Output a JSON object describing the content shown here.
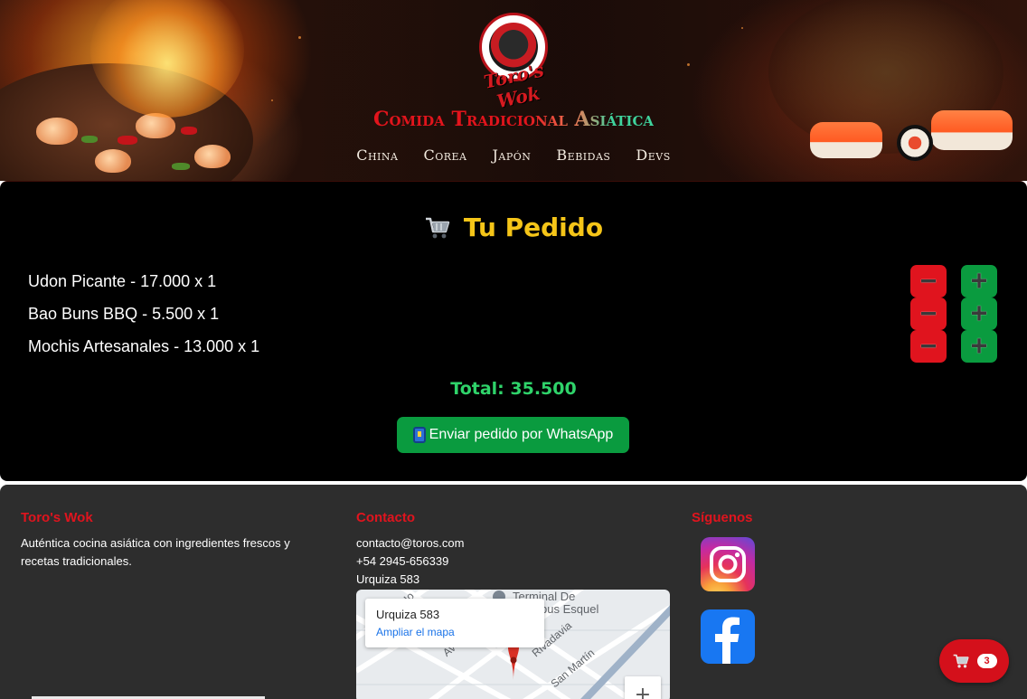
{
  "header": {
    "logo_text": "Toro's Wok",
    "tagline": "Comida Tradicional Asiática",
    "nav": [
      "China",
      "Corea",
      "Japón",
      "Bebidas",
      "Devs"
    ]
  },
  "order": {
    "title": "Tu Pedido",
    "title_icon": "shopping-cart-icon",
    "items": [
      {
        "text": "Udon Picante - 17.000 x 1"
      },
      {
        "text": "Bao Buns BBQ - 5.500 x 1"
      },
      {
        "text": "Mochis Artesanales - 13.000 x 1"
      }
    ],
    "minus_symbol": "➖",
    "plus_symbol": "➕",
    "total": "Total: 35.500",
    "whatsapp_button": "Enviar pedido por WhatsApp",
    "whatsapp_icon": "mobile-phone-icon"
  },
  "footer": {
    "brand": {
      "heading": "Toro's Wok",
      "description": "Auténtica cocina asiática con ingredientes frescos y recetas tradicionales."
    },
    "contact": {
      "heading": "Contacto",
      "email": "contacto@toros.com",
      "phone": "+54 2945-656339",
      "address": "Urquiza 583"
    },
    "map": {
      "place_title": "Urquiza 583",
      "enlarge_link": "Ampliar el mapa",
      "labels": [
        "Terminal De",
        "Ómnibus Esquel",
        "Rivadavia",
        "San Martín",
        "Av",
        "Ado"
      ],
      "zoom_in": "+"
    },
    "social": {
      "heading": "Síguenos",
      "networks": [
        "instagram-icon",
        "facebook-icon"
      ]
    }
  },
  "floating_cart": {
    "count": "3",
    "icon": "shopping-cart-icon"
  },
  "colors": {
    "accent_red": "#e0141e",
    "accent_green": "#0a9b3f",
    "title_yellow": "#f5c518",
    "total_green": "#2fd36a",
    "footer_bg": "#2d2d2d"
  }
}
